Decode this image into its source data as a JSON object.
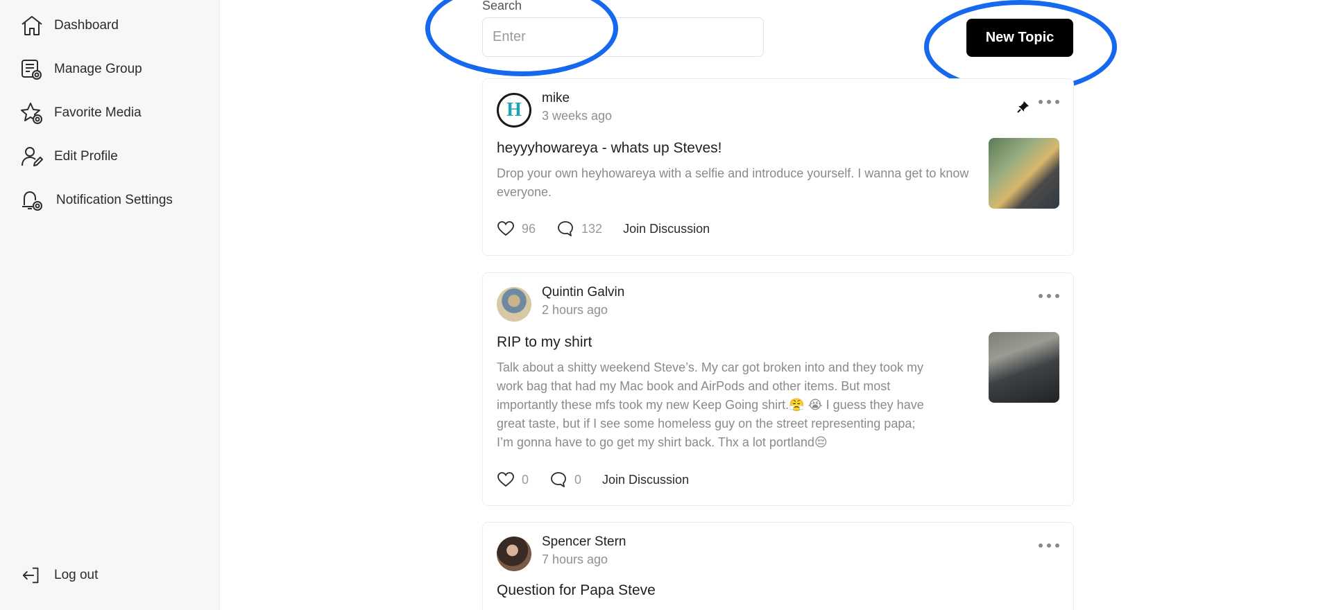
{
  "sidebar": {
    "items": [
      {
        "label": "Dashboard",
        "icon": "home-icon"
      },
      {
        "label": "Manage Group",
        "icon": "manage-group-icon"
      },
      {
        "label": "Favorite Media",
        "icon": "star-settings-icon"
      },
      {
        "label": "Edit Profile",
        "icon": "user-edit-icon"
      },
      {
        "label": "Notification Settings",
        "icon": "bell-settings-icon"
      }
    ],
    "logout_label": "Log out"
  },
  "search": {
    "label": "Search",
    "placeholder": "Enter"
  },
  "new_topic_label": "New Topic",
  "colors": {
    "accent_ring": "#1668ee",
    "button_bg": "#000000",
    "sidebar_bg": "#f7f7f7"
  },
  "posts": [
    {
      "author": "mike",
      "time": "3 weeks ago",
      "title": "heyyyhowareya - whats up Steves!",
      "body": "Drop your own heyhowareya with a selfie and introduce yourself. I wanna get to know everyone.",
      "likes": "96",
      "comments": "132",
      "join_label": "Join Discussion",
      "pinned": true,
      "avatar_letter": "H"
    },
    {
      "author": "Quintin Galvin",
      "time": "2 hours ago",
      "title": "RIP to my shirt",
      "body_lines": [
        "Talk about a shitty weekend Steve’s. My car got broken into and they took my",
        "work bag that had my Mac book and AirPods and other items. But most",
        "importantly these mfs took my new Keep Going shirt.😤 😭 I guess they have",
        "great taste, but if I see some homeless guy on the street representing papa;",
        "I’m gonna have to go get my shirt back. Thx a lot portland😔"
      ],
      "likes": "0",
      "comments": "0",
      "join_label": "Join Discussion"
    },
    {
      "author": "Spencer Stern",
      "time": "7 hours ago",
      "title": "Question for Papa Steve"
    }
  ]
}
